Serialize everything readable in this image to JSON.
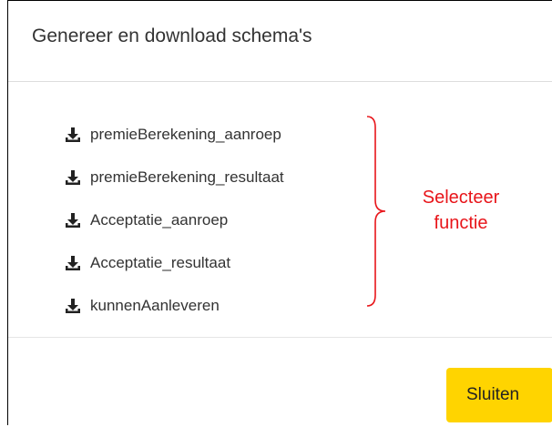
{
  "dialog": {
    "title": "Genereer en download schema's"
  },
  "schemas": [
    {
      "label": "premieBerekening_aanroep",
      "icon": "download-icon"
    },
    {
      "label": "premieBerekening_resultaat",
      "icon": "download-icon"
    },
    {
      "label": "Acceptatie_aanroep",
      "icon": "download-icon"
    },
    {
      "label": "Acceptatie_resultaat",
      "icon": "download-icon"
    },
    {
      "label": "kunnenAanleveren",
      "icon": "download-icon"
    }
  ],
  "annotation": {
    "line1": "Selecteer",
    "line2": "functie",
    "color": "#e8151a"
  },
  "footer": {
    "close_label": "Sluiten",
    "close_color": "#ffd400"
  }
}
